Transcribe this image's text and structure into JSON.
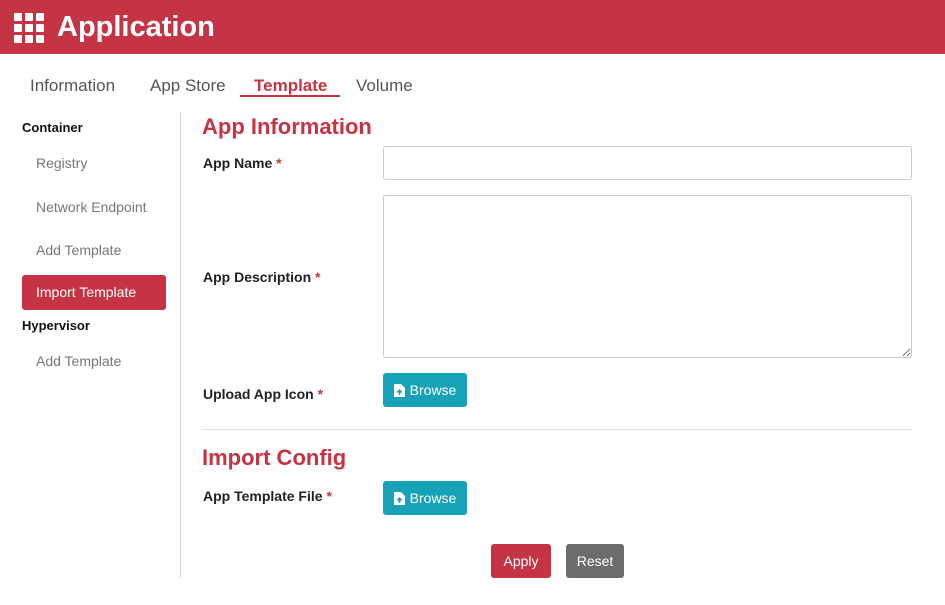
{
  "header": {
    "title": "Application",
    "menu_icon": "grid-icon"
  },
  "tabs": [
    {
      "label": "Information"
    },
    {
      "label": "App Store"
    },
    {
      "label": "Template",
      "active": true
    },
    {
      "label": "Volume"
    }
  ],
  "sidebar": {
    "groups": [
      {
        "heading": "Container",
        "items": [
          {
            "label": "Registry"
          },
          {
            "label": "Network Endpoint"
          },
          {
            "label": "Add Template"
          },
          {
            "label": "Import Template",
            "active": true
          }
        ]
      },
      {
        "heading": "Hypervisor",
        "items": [
          {
            "label": "Add Template"
          }
        ]
      }
    ]
  },
  "form": {
    "app_info_title": "App Information",
    "app_name_label": "App Name",
    "app_name_value": "",
    "app_description_label": "App Description",
    "app_description_value": "",
    "upload_icon_label": "Upload App Icon",
    "required_mark": "*",
    "browse_label": "Browse",
    "import_config_title": "Import Config",
    "template_file_label": "App Template File"
  },
  "actions": {
    "apply_label": "Apply",
    "reset_label": "Reset"
  },
  "colors": {
    "brand": "#c43444",
    "info_button": "#18a2b8",
    "secondary_button": "#6c6c6c"
  }
}
